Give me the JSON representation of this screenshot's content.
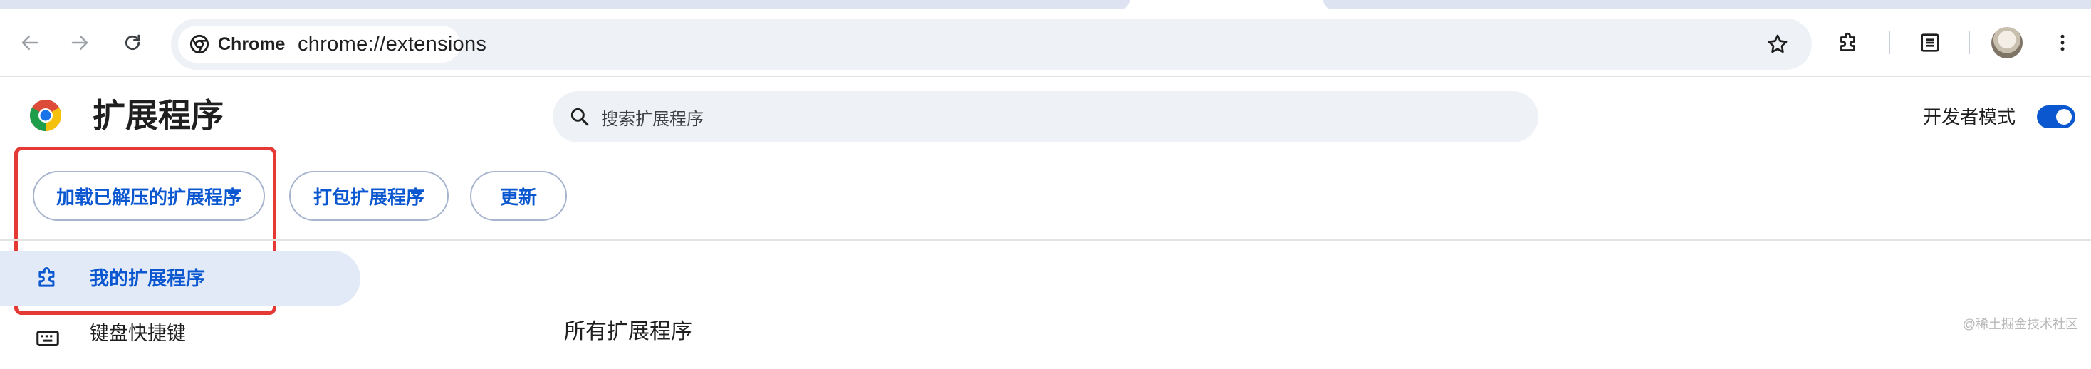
{
  "browser": {
    "chip_label": "Chrome",
    "url": "chrome://extensions",
    "icons": {
      "back": "arrow-left-icon",
      "forward": "arrow-right-icon",
      "reload": "reload-icon",
      "bookmark": "star-icon",
      "extensions": "puzzle-icon",
      "reading_list": "reading-list-icon",
      "profile": "avatar",
      "menu": "kebab-menu-icon"
    }
  },
  "page": {
    "title": "扩展程序",
    "search_placeholder": "搜索扩展程序",
    "developer_mode": {
      "label": "开发者模式",
      "enabled": true
    },
    "actions": {
      "load_unpacked": "加载已解压的扩展程序",
      "pack": "打包扩展程序",
      "update": "更新"
    },
    "sidebar": {
      "items": [
        {
          "label": "我的扩展程序",
          "icon": "puzzle-icon",
          "active": true
        },
        {
          "label": "键盘快捷键",
          "icon": "keyboard-icon",
          "active": false
        }
      ]
    },
    "content_heading": "所有扩展程序",
    "watermark": "@稀土掘金技术社区"
  },
  "colors": {
    "accent": "#0b57d0",
    "highlight": "#e53935",
    "omnibox_bg": "#eef1f6",
    "active_nav_bg": "#e2eaf8"
  }
}
